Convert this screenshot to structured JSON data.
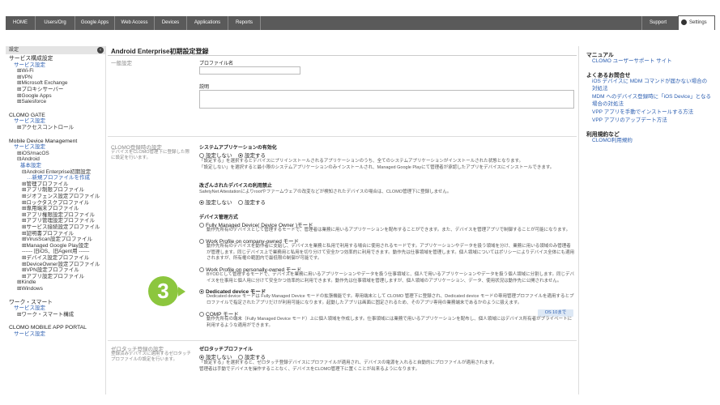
{
  "nav": {
    "items": [
      "HOME",
      "Users/Org",
      "Google Apps",
      "Web Access",
      "Devices",
      "Applications",
      "Reports"
    ],
    "support": "Support",
    "settings": "Settings"
  },
  "sidebar": {
    "header": "設定",
    "collapse_icon": "chevron-left-icon",
    "lines": [
      "サービス構成設定",
      "サービス設定",
      "⊞Wi-Fi",
      "⊞VPN",
      "⊞Microsoft Exchange",
      "⊞プロキシサーバー",
      "⊞Google Apps",
      "⊞Salesforce",
      "CLOMO GATE",
      "サービス設定",
      "⊞アクセスコントロール",
      "Mobile Device Management",
      "サービス設定",
      "⊞iOS/macOS",
      "⊟Android",
      "基本設定",
      "⊟Android Enterprise初期設定",
      "…新規プロファイルを作成",
      "⊞管理プロファイル",
      "⊞アプリ制限プロファイル",
      "⊞ジオフェンス設定プロファイル",
      "⊞ロックタスクプロファイル",
      "⊞専用端末プロファイル",
      "⊞アプリ権限設定プロファイル",
      "⊞アプリ管理設定プロファイル",
      "⊞サービス接続設定プロファイル",
      "⊞証明書プロファイル",
      "⊞VirusScan設定プロファイル",
      "⊞Managed Google Play設定",
      "------ 旧iOS、旧Agent用 ------",
      "⊞デバイス設定プロファイル",
      "⊞DeviceOwner設定プロファイル",
      "⊞VPN設定プロファイル",
      "⊞アプリ設定プロファイル",
      "⊞Kindle",
      "⊞Windows",
      "ワーク・スマート",
      "サービス設定",
      "⊞ワーク・スマート構成",
      "CLOMO MOBILE APP PORTAL",
      "サービス設定"
    ]
  },
  "main": {
    "title": "Android Enterprise初期設定登録",
    "general": {
      "label": "一般設定",
      "profile_name_label": "プロファイル名",
      "profile_name_value": "",
      "description_label": "説明",
      "description_value": ""
    },
    "registration": {
      "label": "CLOMO登録時の設定",
      "desc": "デバイスをCLOMO管理下に登録した際に設定を行います。",
      "sysapp_title": "システムアプリケーションの有効化",
      "sysapp_opt1": "設定しない",
      "sysapp_opt2": "設定する",
      "sysapp_note1": "「設定する」を選択するとデバイスにプリインストールされるアプリケーションのうち、全てのシステムアプリケーションがインストールされた状態となります。",
      "sysapp_note2": "「設定しない」を選択すると最小限のシステムアプリケーションのみインストールされ、Managed Google Playにて管理者が承認したアプリをデバイスにインストールできます。",
      "tampered_title": "改ざんされたデバイスの利用禁止",
      "tampered_note": "SafetyNet Attestationによりrootやファームウェアの改変などが検知されたデバイスの場合は、CLOMO管理下に登録しません。",
      "tampered_opt1": "設定しない",
      "tampered_opt2": "設定する",
      "mgmt_title": "デバイス管理方式",
      "mgmt_opts": [
        {
          "label": "Fully Managed Device( Device Owner )モード",
          "desc": "動作先所有のデバイスとして管理するモードで、管理者は業務に用いるアプリケーションを配布することができます。また、デバイスを管理アプリで制御することが可能になります。"
        },
        {
          "label": "Work Profile on company-owned モード",
          "desc": "動作先所有のデバイスを動作者に支給し、デバイスを業務と私用で利用する場合に使用されるモードです。アプリケーションやデータを扱う領域を分け、業務に用いる領域のみ管理者が管理します。同じデバイス上で業務用と私用を切り分けて安全かつ効率的に利用できます。動作先は仕事領域を管理します。個人領域についてはポリシーによりデバイス全体にも適用されますが、所有権の範囲内で最低限の制御が可能です。"
        },
        {
          "label": "Work Profile on personally-owned モード",
          "desc": "BYODとして管理するモードで、デバイスを業務に用いるアプリケーションやデータを扱う仕事領域と、個人で用いるアプリケーションやデータを扱う個人領域に分割します。同じデバイスを仕事用と個人用に分けて安全かつ効率的に利用できます。動作先は仕事領域を管理しますが、個人領域のアプリケーション、データ、使用状況は動作先に公開されません。"
        },
        {
          "label": "Dedicated device モード",
          "desc": "Dedicated device モードは Fully Managed Device モードの拡張機能です。専用端末として CLOMO 管理下に登録され、Dedicated device モードの専用管理プロファイルを適用するとプロファイルで指定されたアプリだけが利用可能になります。起動したアプリは画面に固定されるため、そのアプリ専用の業務端末であるかのように扱えます。"
        },
        {
          "label": "COMP モード",
          "desc": "動作先所有の端末（Fully Managed Device モード）上に個人領域を作成します。仕事領域には業務で用いるアプリケーションを配布し、個人領域にはデバイス所有者がプライベートに利用するような適用ができます。"
        }
      ],
      "comp_badge": "OS 10まで",
      "step_number": "3"
    },
    "zerotouch": {
      "label": "ゼロタッチ登録の設定",
      "desc": "登録済みデバイスに適用するゼロタッチプロファイルの設定を行います。",
      "title": "ゼロタッチプロファイル",
      "opt1": "設定しない",
      "opt2": "設定する",
      "note1": "「設定する」を選択すると、ゼロタッチ登録デバイスにプロファイルが適用され、デバイスの電源を入れると自動的にプロファイルが適用されます。",
      "note2": "管理者は手動でデバイスを操作することなく、デバイスをCLOMO管理下に置くことが出来るようになります。"
    }
  },
  "right": {
    "manual_title": "マニュアル",
    "manual_link": "CLOMO ユーザーサポート サイト",
    "faq_title": "よくあるお問合せ",
    "faq_links": [
      "iOS デバイスに MDM コマンドが届かない場合の対処法",
      "MDM へのデバイス登録時に「iOS Device」となる場合の対処法",
      "VPP アプリを手動でインストールする方法",
      "VPP アプリのアップデート方法"
    ],
    "terms_title": "利用規約など",
    "terms_link": "CLOMO利用規約"
  }
}
